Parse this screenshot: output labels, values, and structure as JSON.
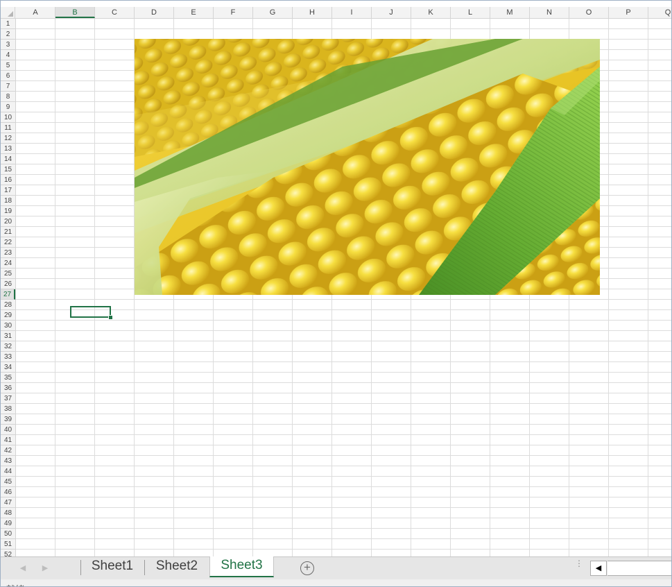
{
  "columns": [
    "A",
    "B",
    "C",
    "D",
    "E",
    "F",
    "G",
    "H",
    "I",
    "J",
    "K",
    "L",
    "M",
    "N",
    "O",
    "P",
    "Q"
  ],
  "active_column": "B",
  "rows": [
    "1",
    "2",
    "3",
    "4",
    "5",
    "6",
    "7",
    "8",
    "9",
    "10",
    "11",
    "12",
    "13",
    "14",
    "15",
    "16",
    "17",
    "18",
    "19",
    "20",
    "21",
    "22",
    "23",
    "24",
    "25",
    "26",
    "27",
    "28",
    "29",
    "30",
    "31",
    "32",
    "33",
    "34",
    "35",
    "36",
    "37",
    "38",
    "39",
    "40",
    "41",
    "42",
    "43",
    "44",
    "45",
    "46",
    "47",
    "48",
    "49",
    "50",
    "51",
    "52"
  ],
  "active_row": "27",
  "selected_cell": "B27",
  "picture": {
    "subject": "corn",
    "description_icon": "corn-image"
  },
  "sheets": [
    {
      "label": "Sheet1",
      "active": false
    },
    {
      "label": "Sheet2",
      "active": false
    },
    {
      "label": "Sheet3",
      "active": true
    }
  ],
  "icons": {
    "prev_sheet": "chevron-left-icon",
    "next_sheet": "chevron-right-icon",
    "add_sheet": "plus-circle-icon",
    "options": "vertical-dots-icon",
    "scroll_left": "triangle-left-icon"
  },
  "tabbar": {
    "add_symbol": "+",
    "prev_symbol": "◀",
    "next_symbol": "▶",
    "scroll_left_symbol": "◀"
  },
  "status": {
    "text": "就緒　　　　　"
  },
  "colors": {
    "accent": "#217346",
    "grid": "#dcdcdc",
    "header_bg": "#f3f3f3",
    "tab_bar": "#e6e6e6"
  }
}
